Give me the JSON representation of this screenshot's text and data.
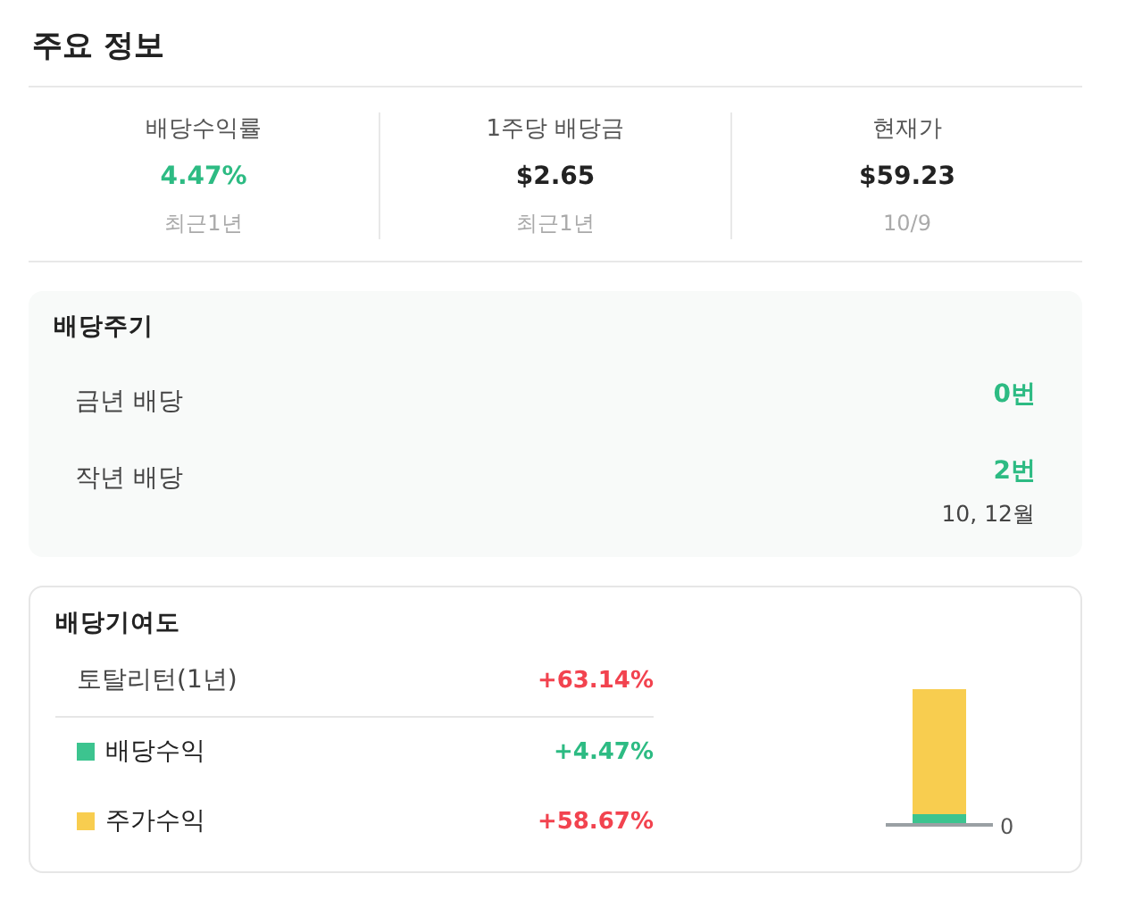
{
  "title": "주요 정보",
  "stats": [
    {
      "label": "배당수익률",
      "value": "4.47%",
      "color": "#2dbb83",
      "note": "최근1년"
    },
    {
      "label": "1주당 배당금",
      "value": "$2.65",
      "color": "#222222",
      "note": "최근1년"
    },
    {
      "label": "현재가",
      "value": "$59.23",
      "color": "#222222",
      "note": "10/9"
    }
  ],
  "dividend_cycle": {
    "title": "배당주기",
    "rows": [
      {
        "label": "금년 배당",
        "count": "0번"
      },
      {
        "label": "작년 배당",
        "count": "2번",
        "months": "10, 12월"
      }
    ]
  },
  "contribution": {
    "title": "배당기여도",
    "rows": [
      {
        "kind": "total",
        "label": "토탈리턴(1년)",
        "value": {
          "text": "+63.14%",
          "color": "#f2434f"
        }
      },
      {
        "kind": "legend",
        "label": "배당수익",
        "value": {
          "text": "+4.47%",
          "color": "#2dbb83"
        },
        "color": "#3cc48f"
      },
      {
        "kind": "legend",
        "label": "주가수익",
        "value": {
          "text": "+58.67%",
          "color": "#f2434f"
        },
        "color": "#f8cd4f"
      }
    ],
    "axis_label": "0"
  }
}
